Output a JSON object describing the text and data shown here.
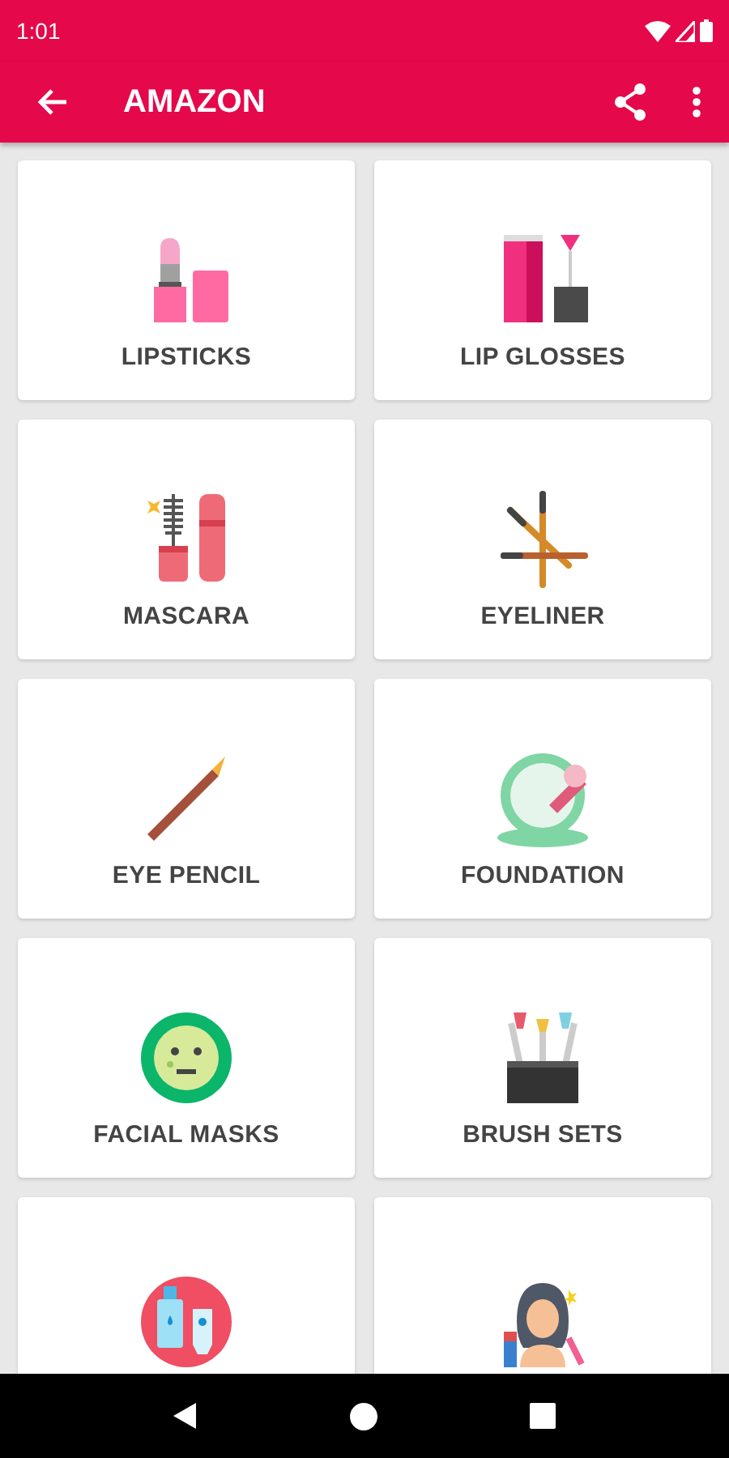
{
  "status_bar": {
    "time": "1:01"
  },
  "app_bar": {
    "title": "AMAZON"
  },
  "categories": [
    {
      "label": "LIPSTICKS"
    },
    {
      "label": "LIP GLOSSES"
    },
    {
      "label": "MASCARA"
    },
    {
      "label": "EYELINER"
    },
    {
      "label": "EYE PENCIL"
    },
    {
      "label": "FOUNDATION"
    },
    {
      "label": "FACIAL MASKS"
    },
    {
      "label": "BRUSH SETS"
    },
    {
      "kind": "icon-only"
    },
    {
      "kind": "icon-only"
    }
  ]
}
